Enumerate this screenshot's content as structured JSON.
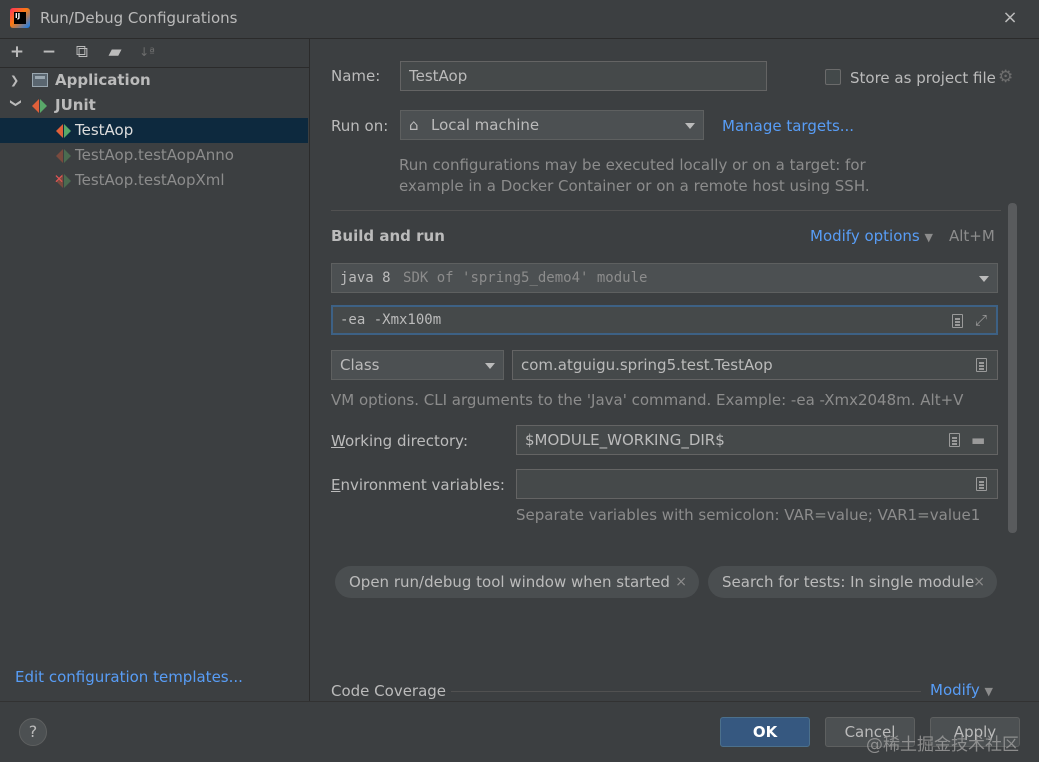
{
  "window": {
    "title": "Run/Debug Configurations",
    "close_icon": "×"
  },
  "left_toolbar": {
    "add": "+",
    "remove": "−",
    "copy": "⧉",
    "folder": "▰",
    "sort": "↓ª"
  },
  "tree": {
    "application_label": "Application",
    "junit_label": "JUnit",
    "items": [
      {
        "label": "TestAop"
      },
      {
        "label": "TestAop.testAopAnno"
      },
      {
        "label": "TestAop.testAopXml"
      }
    ]
  },
  "edit_templates_link": "Edit configuration templates...",
  "form": {
    "name_label": "Name:",
    "name_value": "TestAop",
    "store_as_project_file": "Store as project file",
    "run_on_label": "Run on:",
    "run_on_value": "Local machine",
    "manage_targets": "Manage targets...",
    "run_on_hint_1": "Run configurations may be executed locally or on a target: for",
    "run_on_hint_2": "example in a Docker Container or on a remote host using SSH.",
    "build_and_run": "Build and run",
    "modify_options": "Modify options",
    "modify_shortcut": "Alt+M",
    "jre_main": "java 8",
    "jre_detail": "SDK of 'spring5_demo4' module",
    "vm_options": "-ea -Xmx100m",
    "test_kind": "Class",
    "class_value": "com.atguigu.spring5.test.TestAop",
    "vm_hint": "VM options. CLI arguments to the 'Java' command. Example: -ea -Xmx2048m. Alt+V",
    "working_dir_label": "Working directory:",
    "working_dir_value": "$MODULE_WORKING_DIR$",
    "env_label": "Environment variables:",
    "env_value": "",
    "env_hint": "Separate variables with semicolon: VAR=value; VAR1=value1",
    "chip_1": "Open run/debug tool window when started",
    "chip_2": "Search for tests: In single module",
    "chip_close": "×",
    "code_coverage": "Code Coverage",
    "modify": "Modify"
  },
  "buttons": {
    "help": "?",
    "ok": "OK",
    "cancel": "Cancel",
    "apply": "Apply"
  },
  "watermark": "@稀土掘金技术社区",
  "colors": {
    "accent_link": "#589df6",
    "selection": "#0d293e",
    "primary_button": "#365880"
  }
}
